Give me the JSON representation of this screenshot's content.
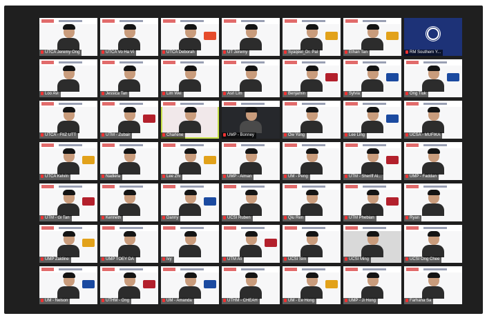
{
  "window": {
    "background": "#1f1f1f",
    "active_speaker_color": "#c9e24a",
    "muted_color": "#e33333"
  },
  "participants": [
    {
      "name": "UTCA Jeremy Ong",
      "bg": "white",
      "logo": ""
    },
    {
      "name": "UTCA Vo Ha Vi",
      "bg": "white",
      "logo": ""
    },
    {
      "name": "UTCA Deborah",
      "bg": "white",
      "logo": "ut"
    },
    {
      "name": "UT Jeremy",
      "bg": "white",
      "logo": ""
    },
    {
      "name": "Syaqeel_Dr. Pal",
      "bg": "white",
      "logo": "um"
    },
    {
      "name": "Ethan Tan",
      "bg": "white",
      "logo": "um"
    },
    {
      "name": "RM Southern Y...",
      "bg": "navy",
      "logo": "",
      "obs": true
    },
    {
      "name": "Loo Avi",
      "bg": "white",
      "logo": ""
    },
    {
      "name": "Jessica Tan",
      "bg": "white",
      "logo": ""
    },
    {
      "name": "Lim Wei",
      "bg": "white",
      "logo": ""
    },
    {
      "name": "Asri Lim",
      "bg": "white",
      "logo": ""
    },
    {
      "name": "Benjamin",
      "bg": "white",
      "logo": "utm"
    },
    {
      "name": "Sylvia",
      "bg": "white",
      "logo": "ums"
    },
    {
      "name": "Ong Tiuk",
      "bg": "white",
      "logo": "ums"
    },
    {
      "name": "UTCA - FIIZ UTT",
      "bg": "white",
      "logo": ""
    },
    {
      "name": "UTM - Zubair",
      "bg": "white",
      "logo": "utm"
    },
    {
      "name": "Charlene",
      "bg": "pink",
      "logo": "",
      "active": true
    },
    {
      "name": "UMP - Bonney",
      "bg": "dark",
      "logo": ""
    },
    {
      "name": "Ow Yong",
      "bg": "white",
      "logo": ""
    },
    {
      "name": "Lee Ling",
      "bg": "white",
      "logo": "ums"
    },
    {
      "name": "UCSA - MUFIKA",
      "bg": "white",
      "logo": ""
    },
    {
      "name": "UTCA Kelvin",
      "bg": "white",
      "logo": "um"
    },
    {
      "name": "Nadiera",
      "bg": "white",
      "logo": ""
    },
    {
      "name": "Lee Zhi",
      "bg": "white",
      "logo": "um"
    },
    {
      "name": "UMP - Aiman",
      "bg": "white",
      "logo": ""
    },
    {
      "name": "UM - Peng",
      "bg": "white",
      "logo": ""
    },
    {
      "name": "UTM - Sheriff Al...",
      "bg": "white",
      "logo": "utm"
    },
    {
      "name": "UMP - Faddan",
      "bg": "white",
      "logo": ""
    },
    {
      "name": "UTM - Gi Tan",
      "bg": "white",
      "logo": "utm"
    },
    {
      "name": "Kenneth",
      "bg": "white",
      "logo": ""
    },
    {
      "name": "Danny",
      "bg": "white",
      "logo": "ums"
    },
    {
      "name": "UCSI Ruben",
      "bg": "white",
      "logo": ""
    },
    {
      "name": "Qiu Ren",
      "bg": "white",
      "logo": ""
    },
    {
      "name": "UTM Phebian",
      "bg": "white",
      "logo": "utm"
    },
    {
      "name": "Ryan",
      "bg": "white",
      "logo": ""
    },
    {
      "name": "UMP Zaidine",
      "bg": "white",
      "logo": "um"
    },
    {
      "name": "UMP TOEY DA",
      "bg": "white",
      "logo": ""
    },
    {
      "name": "Ivy",
      "bg": "white",
      "logo": ""
    },
    {
      "name": "UTM Ali",
      "bg": "white",
      "logo": "utm"
    },
    {
      "name": "UCSI Sim",
      "bg": "white",
      "logo": ""
    },
    {
      "name": "UCSI Ming",
      "bg": "grey",
      "logo": ""
    },
    {
      "name": "UCSI Ong Chee",
      "bg": "white",
      "logo": ""
    },
    {
      "name": "UM - Nelson",
      "bg": "white",
      "logo": "ums"
    },
    {
      "name": "UTHM - Ong",
      "bg": "white",
      "logo": "utm"
    },
    {
      "name": "UM - Amanda",
      "bg": "white",
      "logo": "ums"
    },
    {
      "name": "UTHM - CHEAH",
      "bg": "white",
      "logo": ""
    },
    {
      "name": "UM - Ee Hong",
      "bg": "white",
      "logo": "um"
    },
    {
      "name": "UMP - Ji Hong",
      "bg": "white",
      "logo": ""
    },
    {
      "name": "Farhana Sa",
      "bg": "white",
      "logo": ""
    }
  ]
}
